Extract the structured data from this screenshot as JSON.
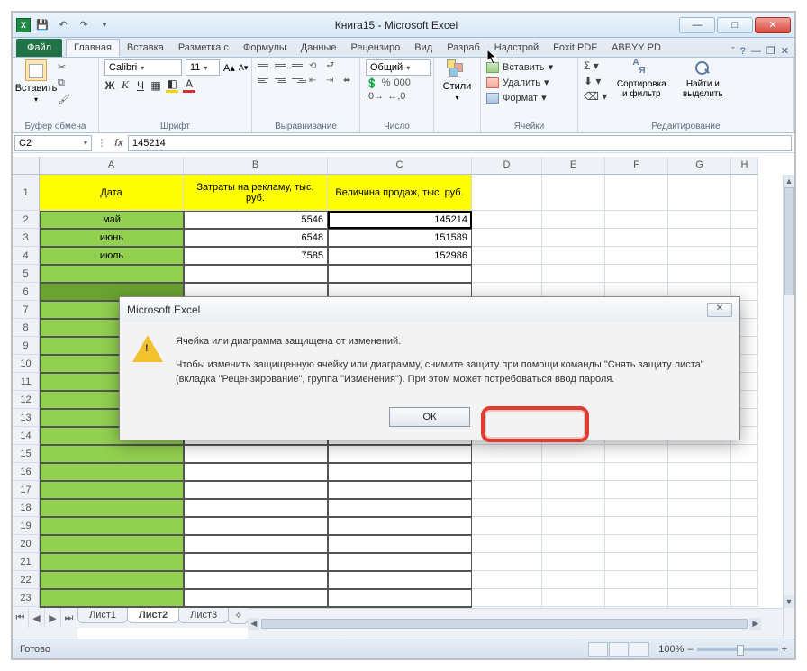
{
  "window": {
    "title": "Книга15 - Microsoft Excel"
  },
  "tabs": {
    "file": "Файл",
    "items": [
      "Главная",
      "Вставка",
      "Разметка с",
      "Формулы",
      "Данные",
      "Рецензиро",
      "Вид",
      "Разраб",
      "Надстрой",
      "Foxit PDF",
      "ABBYY PD"
    ],
    "active_index": 0
  },
  "ribbon": {
    "clipboard": {
      "paste": "Вставить",
      "label": "Буфер обмена"
    },
    "font": {
      "name": "Calibri",
      "size": "11",
      "label": "Шрифт"
    },
    "align": {
      "label": "Выравнивание"
    },
    "number": {
      "format": "Общий",
      "label": "Число"
    },
    "styles": {
      "title": "Стили"
    },
    "cells": {
      "insert": "Вставить",
      "delete": "Удалить",
      "format": "Формат",
      "label": "Ячейки"
    },
    "editing": {
      "sort": "Сортировка и фильтр",
      "find": "Найти и выделить",
      "label": "Редактирование"
    }
  },
  "formula_bar": {
    "name_box": "C2",
    "value": "145214"
  },
  "columns": [
    "A",
    "B",
    "C",
    "D",
    "E",
    "F",
    "G",
    "H"
  ],
  "rows": [
    {
      "n": 1,
      "cells": [
        "Дата",
        "Затраты на рекламу, тыс. руб.",
        "Величина продаж, тыс. руб."
      ],
      "header": true
    },
    {
      "n": 2,
      "cells": [
        "май",
        "5546",
        "145214"
      ],
      "sel": 2
    },
    {
      "n": 3,
      "cells": [
        "июнь",
        "6548",
        "151589"
      ]
    },
    {
      "n": 4,
      "cells": [
        "июль",
        "7585",
        "152986"
      ]
    },
    {
      "n": 5,
      "cells": [
        "",
        "",
        ""
      ]
    },
    {
      "n": 6,
      "cells": [
        "",
        "",
        ""
      ],
      "greenonly": true
    }
  ],
  "blank_start": 7,
  "blank_end": 24,
  "sheet_tabs": {
    "items": [
      "Лист1",
      "Лист2",
      "Лист3"
    ],
    "active": 1
  },
  "status": {
    "ready": "Готово",
    "zoom": "100%"
  },
  "dialog": {
    "title": "Microsoft Excel",
    "line1": "Ячейка или диаграмма защищена от изменений.",
    "line2": "Чтобы изменить защищенную ячейку или диаграмму, снимите защиту при помощи команды \"Снять защиту листа\" (вкладка \"Рецензирование\", группа \"Изменения\"). При этом может потребоваться ввод пароля.",
    "ok": "ОК"
  }
}
